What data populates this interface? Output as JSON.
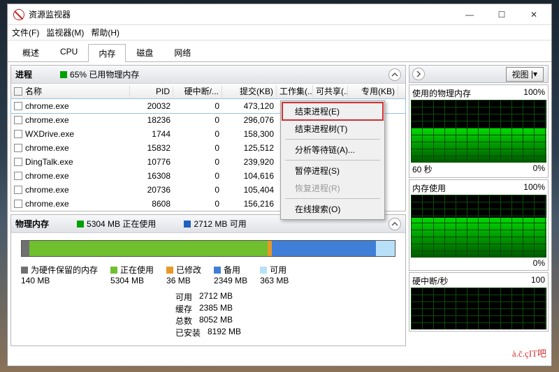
{
  "window": {
    "title": "资源监视器"
  },
  "menubar": {
    "file": "文件(F)",
    "monitor": "监视器(M)",
    "help": "帮助(H)"
  },
  "tabs": {
    "overview": "概述",
    "cpu": "CPU",
    "memory": "内存",
    "disk": "磁盘",
    "network": "网络",
    "active": "memory"
  },
  "processes_panel": {
    "title": "进程",
    "usage_color": "#00a000",
    "usage_text": "65% 已用物理内存",
    "cols": {
      "name": "名称",
      "pid": "PID",
      "hardfaults": "硬中断/...",
      "commit": "提交(KB)",
      "ws": "工作集(...",
      "share": "可共享(...",
      "private": "专用(KB)"
    },
    "rows": [
      {
        "name": "chrome.exe",
        "pid": "20032",
        "hf": "0",
        "commit": "473,120",
        "sel": true
      },
      {
        "name": "chrome.exe",
        "pid": "18236",
        "hf": "0",
        "commit": "296,076"
      },
      {
        "name": "WXDrive.exe",
        "pid": "1744",
        "hf": "0",
        "commit": "158,300"
      },
      {
        "name": "chrome.exe",
        "pid": "15832",
        "hf": "0",
        "commit": "125,512"
      },
      {
        "name": "DingTalk.exe",
        "pid": "10776",
        "hf": "0",
        "commit": "239,920"
      },
      {
        "name": "chrome.exe",
        "pid": "16308",
        "hf": "0",
        "commit": "104,616"
      },
      {
        "name": "chrome.exe",
        "pid": "20736",
        "hf": "0",
        "commit": "105,404"
      },
      {
        "name": "chrome.exe",
        "pid": "8608",
        "hf": "0",
        "commit": "156,216"
      }
    ]
  },
  "context_menu": {
    "end_process": "结束进程(E)",
    "end_tree": "结束进程树(T)",
    "analyze_wait": "分析等待链(A)...",
    "suspend": "暂停进程(S)",
    "resume": "恢复进程(R)",
    "search_online": "在线搜索(O)"
  },
  "physmem_panel": {
    "title": "物理内存",
    "inuse_color": "#00a000",
    "inuse_text": "5304 MB 正在使用",
    "avail_color": "#2060c0",
    "avail_text": "2712 MB 可用",
    "legend": [
      {
        "color": "#707070",
        "label": "为硬件保留的内存",
        "value": "140 MB"
      },
      {
        "color": "#6fbf2f",
        "label": "正在使用",
        "value": "5304 MB"
      },
      {
        "color": "#e89828",
        "label": "已修改",
        "value": "36 MB"
      },
      {
        "color": "#3f7fd8",
        "label": "备用",
        "value": "2349 MB"
      },
      {
        "color": "#b8e0f8",
        "label": "可用",
        "value": "363 MB"
      }
    ],
    "stats": {
      "avail_l": "可用",
      "avail_v": "2712 MB",
      "cache_l": "缓存",
      "cache_v": "2385 MB",
      "total_l": "总数",
      "total_v": "8052 MB",
      "installed_l": "已安装",
      "installed_v": "8192 MB"
    }
  },
  "right": {
    "view_btn": "视图",
    "g1_title": "使用的物理内存",
    "g1_r": "100%",
    "g1_bl": "60 秒",
    "g1_br": "0%",
    "g2_title": "内存使用",
    "g2_r": "100%",
    "g2_br": "0%",
    "g3_title": "硬中断/秒",
    "g3_r": "100"
  },
  "watermark": "à.č.çIT吧"
}
